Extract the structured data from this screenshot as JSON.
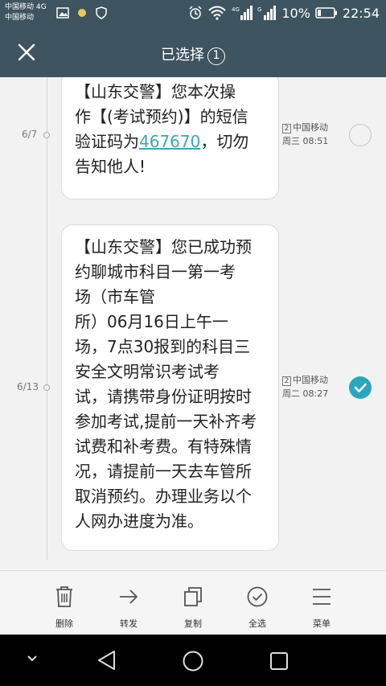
{
  "status_bar": {
    "carrier_line1": "中国移动 4G",
    "carrier_line2": "中国移动",
    "battery": "10%",
    "time": "22:54"
  },
  "header": {
    "title": "已选择",
    "selected_count": "1"
  },
  "messages": [
    {
      "date": "6/7",
      "lines": [
        "【山东交警】您本次操",
        "作【(考试预约)】的短信",
        "验证码为"
      ],
      "code": "467670",
      "after_code": "，切勿",
      "last_line": "告知他人!",
      "sim": "2",
      "sender": "中国移动",
      "time": "周三 08:51",
      "selected": false
    },
    {
      "date": "6/13",
      "lines": [
        "【山东交警】您已成功预",
        "约聊城市科目一第一考",
        "场（市车管",
        "所）06月16日上午一",
        "场，7点30报到的科目三",
        "安全文明常识考试考",
        "试，请携带身份证明按时",
        "参加考试,提前一天补齐考",
        "试费和补考费。有特殊情",
        "况，请提前一天去车管所",
        "取消预约。办理业务以个",
        "人网办进度为准。"
      ],
      "sim": "2",
      "sender": "中国移动",
      "time": "周二 08:27",
      "selected": true
    }
  ],
  "toolbar": {
    "delete": "删除",
    "forward": "转发",
    "copy": "复制",
    "select_all": "全选",
    "menu": "菜单"
  },
  "colors": {
    "header_bg": "#3e5460",
    "accent": "#2aa7bb",
    "link": "#3fa6b6"
  },
  "icons": [
    "close-icon",
    "trash-icon",
    "arrow-right-icon",
    "copy-icon",
    "check-circle-icon",
    "menu-icon",
    "back-icon",
    "home-icon",
    "recents-icon",
    "chevron-down-icon"
  ]
}
